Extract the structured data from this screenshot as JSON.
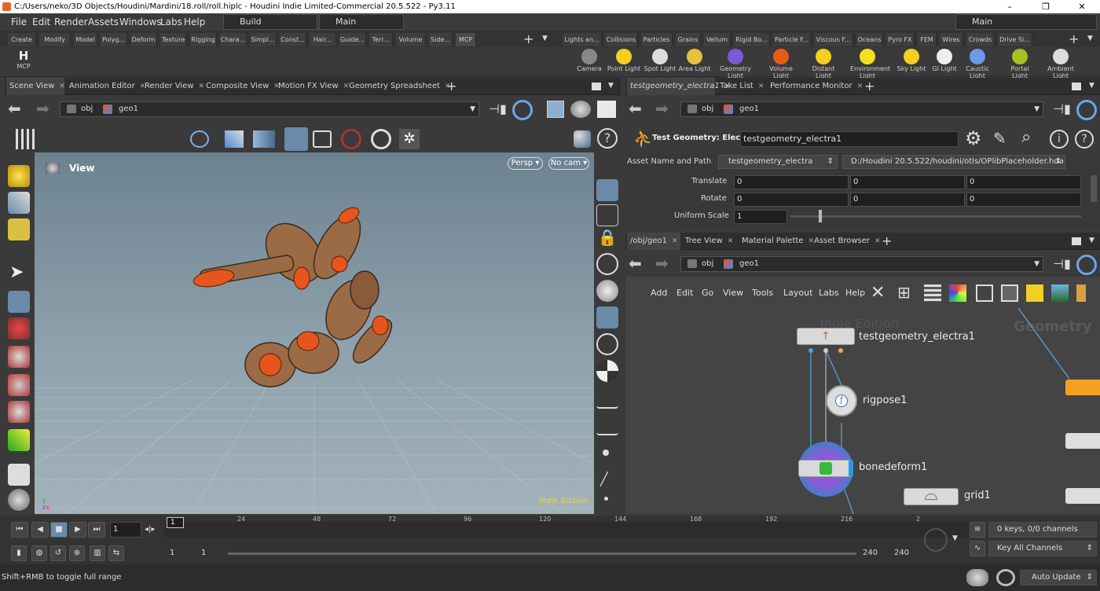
{
  "window": {
    "title": "C:/Users/neko/3D Objects/Houdini/Mardini/18.roll/roll.hiplc - Houdini Indie Limited-Commercial 20.5.522 - Py3.11",
    "controls": [
      "–",
      "❐",
      "✕"
    ]
  },
  "menu": {
    "items": [
      "File",
      "Edit",
      "Render",
      "Assets",
      "Windows",
      "Labs",
      "Help"
    ],
    "desktop": "Build",
    "context": "Main",
    "right_context": "Main"
  },
  "shelf_left": {
    "tabs": [
      "Create",
      "Modify",
      "Model",
      "Polyg...",
      "Deform",
      "Texture",
      "Rigging",
      "Chara...",
      "Simpl...",
      "Const...",
      "Hair...",
      "Guide...",
      "Terr...",
      "Volume",
      "Side...",
      "MCP"
    ],
    "tools": [
      {
        "label": "MCP",
        "icon": "h-logo-icon"
      }
    ]
  },
  "shelf_right": {
    "tabs": [
      "Lights an...",
      "Collisions",
      "Particles",
      "Grains",
      "Vellum",
      "Rigid Bo...",
      "Particle F...",
      "Viscous F...",
      "Oceans",
      "Pyro FX",
      "FEM",
      "Wires",
      "Crowds",
      "Drive Si..."
    ],
    "tools": [
      "Camera",
      "Point Light",
      "Spot Light",
      "Area Light",
      "Geometry Light",
      "Volume Light",
      "Distant Light",
      "Environment Light",
      "Sky Light",
      "GI Light",
      "Caustic Light",
      "Portal Light",
      "Ambient Light"
    ]
  },
  "left_pane": {
    "tabs": [
      "Scene View",
      "Animation Editor",
      "Render View",
      "Composite View",
      "Motion FX View",
      "Geometry Spreadsheet"
    ],
    "path": {
      "root": "obj",
      "node": "geo1"
    },
    "view_label": "View",
    "persp": "Persp",
    "cam": "No cam",
    "watermark": "Indie Edition"
  },
  "param_pane": {
    "tabs": [
      "testgeometry_electra1",
      "Take List",
      "Performance Monitor"
    ],
    "path": {
      "root": "obj",
      "node": "geo1"
    },
    "node_type": "Test Geometry: Electra",
    "node_name": "testgeometry_electra1",
    "asset_label": "Asset Name and Path",
    "asset_name": "testgeometry_electra",
    "asset_path": "D:/Houdini 20.5.522/houdini/otls/OPlibPlaceholder.hda",
    "translate_label": "Translate",
    "translate": [
      "0",
      "0",
      "0"
    ],
    "rotate_label": "Rotate",
    "rotate": [
      "0",
      "0",
      "0"
    ],
    "scale_label": "Uniform Scale",
    "scale": "1"
  },
  "network_pane": {
    "tabs": [
      "/obj/geo1",
      "Tree View",
      "Material Palette",
      "Asset Browser"
    ],
    "path": {
      "root": "obj",
      "node": "geo1"
    },
    "menu": [
      "Add",
      "Edit",
      "Go",
      "View",
      "Tools",
      "Layout",
      "Labs",
      "Help"
    ],
    "watermark": "Indie Edition",
    "context_label": "Geometry",
    "nodes": [
      {
        "name": "testgeometry_electra1"
      },
      {
        "name": "rigpose1"
      },
      {
        "name": "bonedeform1"
      },
      {
        "name": "grid1"
      }
    ]
  },
  "timeline": {
    "current_frame": "1",
    "frame_marker": "1",
    "ticks": [
      "24",
      "48",
      "72",
      "96",
      "120",
      "144",
      "168",
      "192",
      "216",
      "2"
    ],
    "start": "1",
    "start2": "1",
    "end": "240",
    "end2": "240",
    "keys_info": "0 keys, 0/0 channels",
    "key_mode": "Key All Channels"
  },
  "status": {
    "message": "Shift+RMB to toggle full range",
    "update_mode": "Auto Update"
  }
}
